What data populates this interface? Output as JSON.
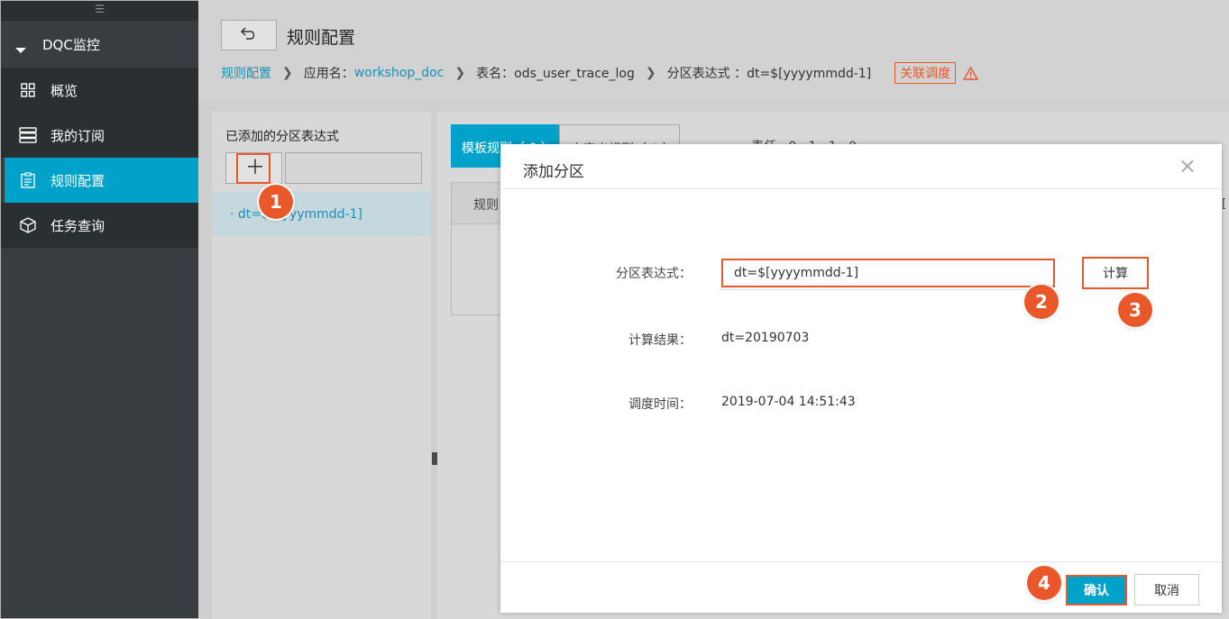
{
  "sidebar": {
    "grip": "☰",
    "group_label": "DQC监控",
    "items": [
      {
        "label": "概览",
        "icon": "grid-icon"
      },
      {
        "label": "我的订阅",
        "icon": "server-icon"
      },
      {
        "label": "规则配置",
        "icon": "clipboard-icon",
        "active": true
      },
      {
        "label": "任务查询",
        "icon": "cube-icon"
      }
    ]
  },
  "header": {
    "back_icon": "⮌",
    "title": "规则配置",
    "breadcrumb": {
      "root": "规则配置",
      "app_label": "应用名：",
      "app_value": "workshop_doc",
      "table_label": "表名：ods_user_trace_log",
      "partition_label": "分区表达式 ：dt=$[yyyymmdd-1]",
      "badge": "关联调度"
    }
  },
  "left_panel": {
    "title": "已添加的分区表达式",
    "add_icon": "＋",
    "list": [
      {
        "label": "· dt=$[yyyymmdd-1]"
      }
    ]
  },
  "right_panel": {
    "tab_template": "模板规则（ 0 ）",
    "tab_custom": "自定义规则（ 0 ）",
    "fragment_text": "表任 , 0 , 1 , 1 , 0",
    "table_header": "规则",
    "edge_char": "["
  },
  "modal": {
    "title": "添加分区",
    "close_icon": "×",
    "expr_label": "分区表达式：",
    "expr_value": "dt=$[yyyymmdd-1]",
    "calc_button": "计算",
    "result_label": "计算结果：",
    "result_value": "dt=20190703",
    "schedule_label": "调度时间：",
    "schedule_value": "2019-07-04 14:51:43",
    "ok_button": "确认",
    "cancel_button": "取消"
  },
  "steps": [
    "1",
    "2",
    "3",
    "4"
  ],
  "colors": {
    "accent": "#00a2ca",
    "highlight": "#e8582a",
    "sidebar_bg": "#373d41",
    "link": "#1c8fb5"
  }
}
